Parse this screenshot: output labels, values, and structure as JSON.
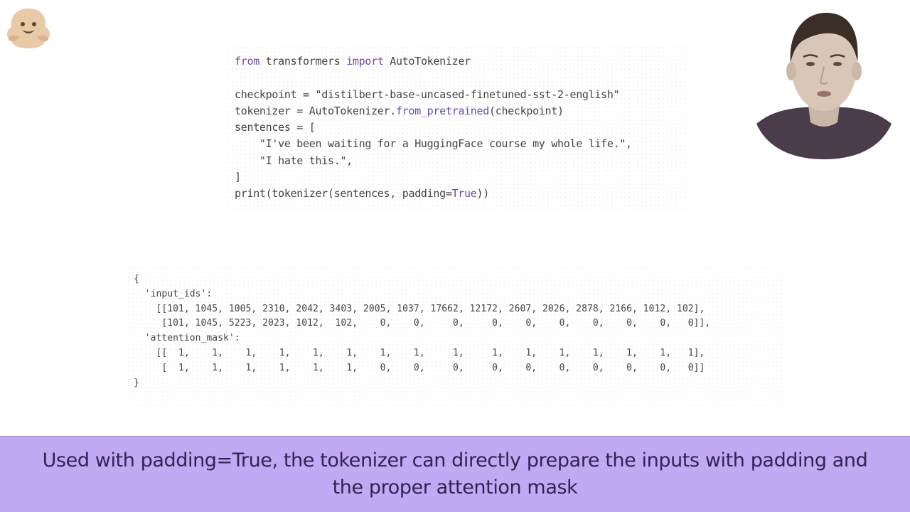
{
  "code": {
    "lines": [
      {
        "parts": [
          {
            "t": "from",
            "kw": true
          },
          {
            "t": " transformers "
          },
          {
            "t": "import",
            "kw": true
          },
          {
            "t": " AutoTokenizer"
          }
        ]
      },
      {
        "parts": [
          {
            "t": ""
          }
        ]
      },
      {
        "parts": [
          {
            "t": "checkpoint = \"distilbert-base-uncased-finetuned-sst-2-english\""
          }
        ]
      },
      {
        "parts": [
          {
            "t": "tokenizer = AutoTokenizer."
          },
          {
            "t": "from_pretrained",
            "kw": true
          },
          {
            "t": "(checkpoint)"
          }
        ]
      },
      {
        "parts": [
          {
            "t": "sentences = ["
          }
        ]
      },
      {
        "parts": [
          {
            "t": "    \"I've been waiting for a HuggingFace course my whole life.\","
          }
        ]
      },
      {
        "parts": [
          {
            "t": "    \"I hate this.\","
          }
        ]
      },
      {
        "parts": [
          {
            "t": "]"
          }
        ]
      },
      {
        "parts": [
          {
            "t": "print(tokenizer(sentences, padding="
          },
          {
            "t": "True",
            "kw": true
          },
          {
            "t": "))"
          }
        ]
      }
    ]
  },
  "output": {
    "lines": [
      "{",
      "  'input_ids':",
      "    [[101, 1045, 1005, 2310, 2042, 3403, 2005, 1037, 17662, 12172, 2607, 2026, 2878, 2166, 1012, 102],",
      "     [101, 1045, 5223, 2023, 1012,  102,    0,    0,     0,     0,    0,    0,    0,    0,    0,   0]],",
      "  'attention_mask':",
      "    [[  1,    1,    1,    1,    1,    1,    1,    1,     1,     1,    1,    1,    1,    1,    1,   1],",
      "     [  1,    1,    1,    1,    1,    1,    0,    0,     0,     0,    0,    0,    0,    0,    0,   0]]",
      "}"
    ]
  },
  "caption": {
    "line1": "Used with padding=True, the tokenizer can directly prepare the inputs with padding and",
    "line2": "the proper attention mask"
  },
  "colors": {
    "caption_bg": "#c1a9f3",
    "keyword": "#6b4aa8",
    "code_text": "#444444"
  },
  "icons": {
    "logo": "hugging-face-logo",
    "presenter": "presenter-video"
  }
}
